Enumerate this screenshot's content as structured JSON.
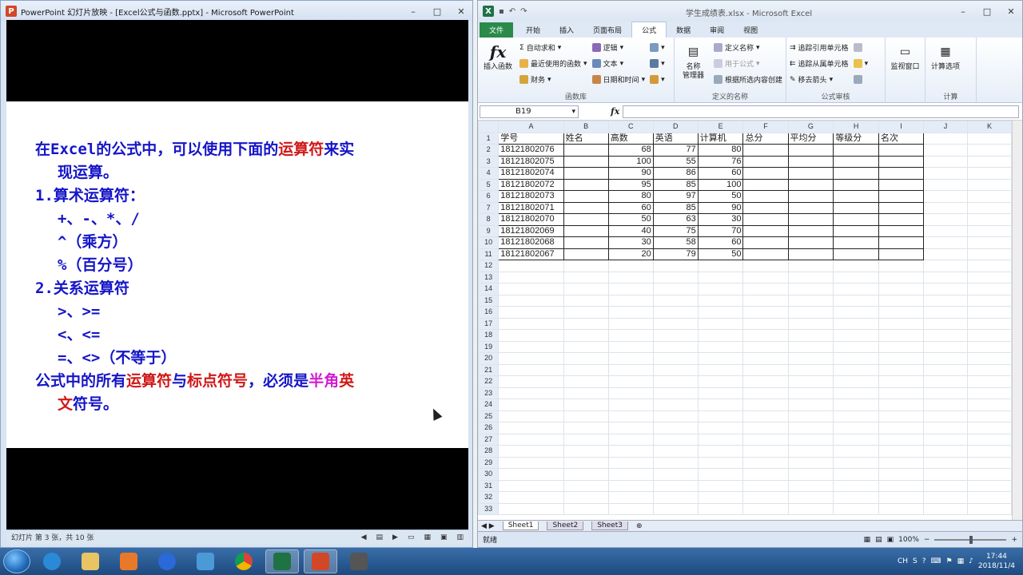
{
  "ppt": {
    "title": "PowerPoint 幻灯片放映 - [Excel公式与函数.pptx] - Microsoft PowerPoint",
    "status": "幻灯片 第 3 张，共 10 张",
    "slide": {
      "l1a": "在Excel的公式中，可以使用下面的",
      "l1b": "运算符",
      "l1c": "来实",
      "l2": "现运算。",
      "l3": "1.算术运算符：",
      "l4": "+、-、*、/",
      "l5": "^（乘方）",
      "l6": "%（百分号）",
      "l7": "2.关系运算符",
      "l8": ">、>=",
      "l9": "<、<=",
      "l10": "=、<>（不等于）",
      "l11a": "公式中的所有",
      "l11b": "运算符",
      "l11c": "与",
      "l11d": "标点符号",
      "l11e": "，必须是",
      "l11f": "半角",
      "l11g": "英",
      "l12a": "文",
      "l12b": "符号。"
    }
  },
  "excel": {
    "title": "学生成绩表.xlsx - Microsoft Excel",
    "tabs": [
      "文件",
      "开始",
      "插入",
      "页面布局",
      "公式",
      "数据",
      "审阅",
      "视图"
    ],
    "ribbon": {
      "insert_fn": "插入函数",
      "autosum": "自动求和",
      "recent": "最近使用的函数",
      "finance": "财务",
      "logic": "逻辑",
      "text": "文本",
      "datetime": "日期和时间",
      "lib_label": "函数库",
      "name_mgr_1": "名称",
      "name_mgr_2": "管理器",
      "define_name": "定义名称",
      "use_in_formula": "用于公式",
      "create_from_sel": "根据所选内容创建",
      "names_label": "定义的名称",
      "trace_prec": "追踪引用单元格",
      "trace_dep": "追踪从属单元格",
      "remove_arrows": "移去箭头",
      "audit_label": "公式审核",
      "watch": "监视窗口",
      "calc_opts": "计算选项",
      "calc_label": "计算"
    },
    "name_box": "B19",
    "fx": "fx",
    "columns": [
      "A",
      "B",
      "C",
      "D",
      "E",
      "F",
      "G",
      "H",
      "I",
      "J",
      "K"
    ],
    "headers": [
      "学号",
      "姓名",
      "高数",
      "英语",
      "计算机",
      "总分",
      "平均分",
      "等级分",
      "名次"
    ],
    "rows": [
      [
        "18121802076",
        "",
        "68",
        "77",
        "80"
      ],
      [
        "18121802075",
        "",
        "100",
        "55",
        "76"
      ],
      [
        "18121802074",
        "",
        "90",
        "86",
        "60"
      ],
      [
        "18121802072",
        "",
        "95",
        "85",
        "100"
      ],
      [
        "18121802073",
        "",
        "80",
        "97",
        "50"
      ],
      [
        "18121802071",
        "",
        "60",
        "85",
        "90"
      ],
      [
        "18121802070",
        "",
        "50",
        "63",
        "30"
      ],
      [
        "18121802069",
        "",
        "40",
        "75",
        "70"
      ],
      [
        "18121802068",
        "",
        "30",
        "58",
        "60"
      ],
      [
        "18121802067",
        "",
        "20",
        "79",
        "50"
      ]
    ],
    "sheets": [
      "Sheet1",
      "Sheet2",
      "Sheet3"
    ],
    "status": "就绪",
    "zoom": "100%"
  },
  "taskbar": {
    "lang": "CH",
    "time": "17:44",
    "date": "2018/11/4"
  }
}
